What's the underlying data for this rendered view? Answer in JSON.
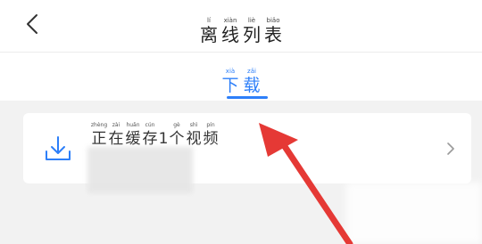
{
  "header": {
    "back_label": "<",
    "title": [
      {
        "py": "lí",
        "hz": "离"
      },
      {
        "py": "xiàn",
        "hz": "线"
      },
      {
        "py": "liè",
        "hz": "列"
      },
      {
        "py": "biǎo",
        "hz": "表"
      }
    ]
  },
  "tabs": [
    {
      "chars": [
        {
          "py": "xià",
          "hz": "下"
        },
        {
          "py": "zǎi",
          "hz": "载"
        }
      ],
      "active": true
    }
  ],
  "card": {
    "status": [
      {
        "py": "zhèng",
        "hz": "正"
      },
      {
        "py": "zài",
        "hz": "在"
      },
      {
        "py": "huǎn",
        "hz": "缓"
      },
      {
        "py": "cún",
        "hz": "存"
      },
      {
        "py": "",
        "hz": "1"
      },
      {
        "py": "gè",
        "hz": "个"
      },
      {
        "py": "shì",
        "hz": "视"
      },
      {
        "py": "pín",
        "hz": "频"
      }
    ],
    "icon": "download-icon"
  },
  "colors": {
    "accent": "#2d7ff9",
    "annotation_arrow": "#e53935",
    "background": "#f2f2f2"
  }
}
